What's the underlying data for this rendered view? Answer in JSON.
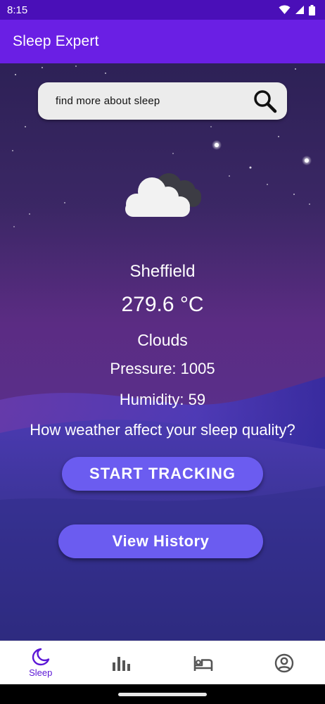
{
  "status_bar": {
    "time": "8:15",
    "icons": [
      "wifi-icon",
      "signal-icon",
      "battery-icon"
    ]
  },
  "app_bar": {
    "title": "Sleep Expert",
    "color": "#6a1fe4"
  },
  "search": {
    "text": "find more about  sleep",
    "icon": "search-icon"
  },
  "weather": {
    "icon": "cloud-icon",
    "city": "Sheffield",
    "temperature": "279.6 °C",
    "description": "Clouds",
    "pressure": "Pressure: 1005",
    "humidity": "Humidity: 59",
    "question": "How weather affect your sleep quality?"
  },
  "buttons": {
    "start_tracking": "START TRACKING",
    "view_history": "View History",
    "color": "#6b5cf0"
  },
  "bottom_nav": {
    "items": [
      {
        "label": "Sleep",
        "icon": "moon-icon",
        "active": true
      },
      {
        "icon": "bar-chart-icon"
      },
      {
        "icon": "bed-icon"
      },
      {
        "icon": "account-icon"
      }
    ],
    "active_color": "#5b16d6"
  }
}
